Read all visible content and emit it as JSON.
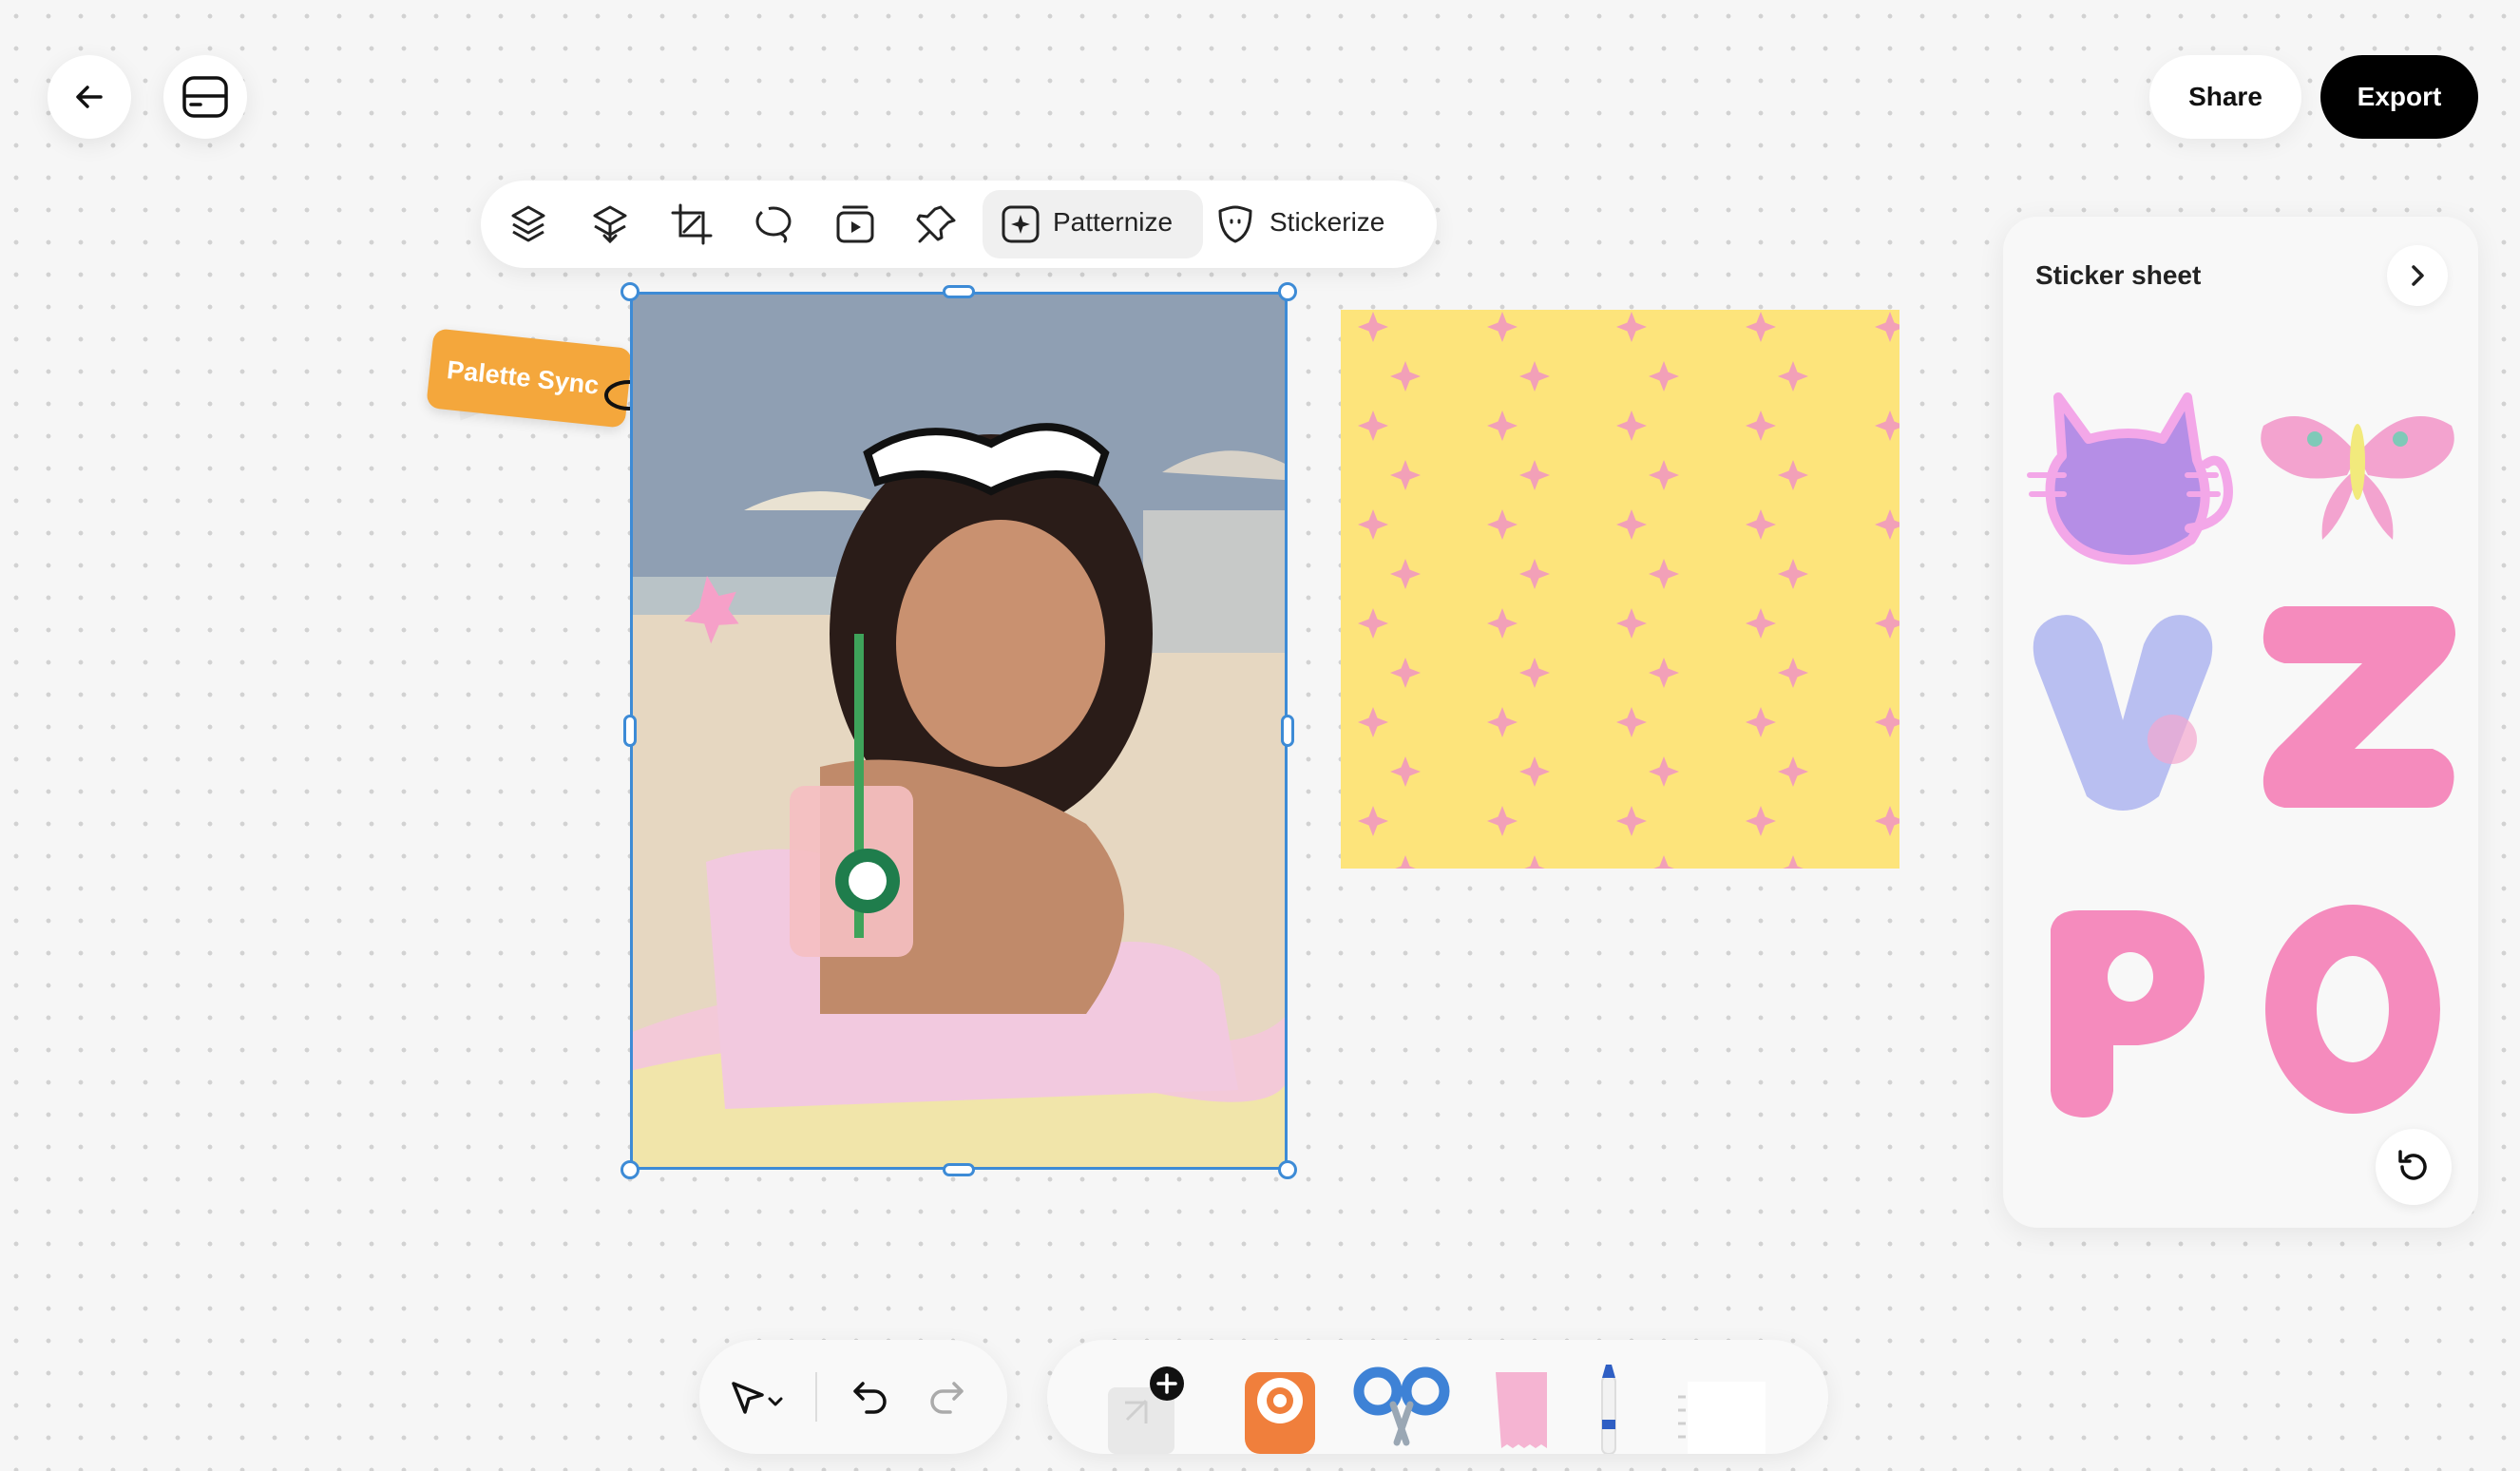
{
  "header": {
    "back_icon": "arrow-left-icon",
    "layers_icon": "layers-toggle-icon",
    "share_label": "Share",
    "export_label": "Export"
  },
  "toolbar": {
    "items": [
      {
        "icon": "lift-subject-icon"
      },
      {
        "icon": "remove-background-icon"
      },
      {
        "icon": "crop-icon"
      },
      {
        "icon": "lasso-icon"
      },
      {
        "icon": "animate-icon"
      },
      {
        "icon": "pin-icon"
      }
    ],
    "patternize_label": "Patternize",
    "stickerize_label": "Stickerize"
  },
  "canvas": {
    "palette_sync_label": "Palette Sync",
    "palette_colors": [
      "#f4a73c",
      "#f27fcf",
      "#f7a7a0",
      "#f6d8cc",
      "#ececec"
    ],
    "pattern_color": "#fde47b",
    "pattern_star_color": "#f2a0b8",
    "selection_color": "#3d8bd6"
  },
  "sticker_panel": {
    "title": "Sticker sheet",
    "stickers": [
      {
        "name": "cat"
      },
      {
        "name": "moth"
      },
      {
        "name": "letter-v"
      },
      {
        "name": "letter-z"
      },
      {
        "name": "letter-p"
      },
      {
        "name": "letter-o"
      }
    ],
    "sticker_letters": [
      "V",
      "Z",
      "P",
      "O"
    ],
    "refresh_icon": "refresh-icon"
  },
  "bottom_bar": {
    "select_icon": "pointer-select-icon",
    "undo_icon": "undo-icon",
    "redo_icon": "redo-icon",
    "craft_tools": [
      {
        "name": "photo-add"
      },
      {
        "name": "hole-punch"
      },
      {
        "name": "scissors"
      },
      {
        "name": "washi-tape"
      },
      {
        "name": "marker"
      },
      {
        "name": "note-paper"
      }
    ]
  }
}
